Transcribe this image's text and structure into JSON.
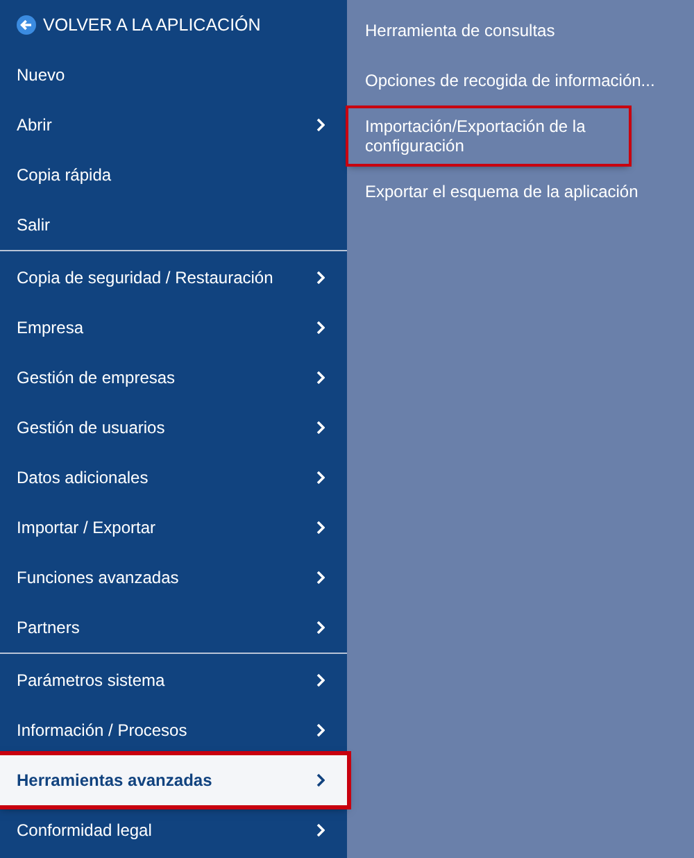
{
  "back_link": {
    "label": "VOLVER A LA APLICACIÓN"
  },
  "menu_groups": [
    {
      "items": [
        {
          "label": "Nuevo",
          "has_submenu": false,
          "selected": false,
          "highlighted": false
        },
        {
          "label": "Abrir",
          "has_submenu": true,
          "selected": false,
          "highlighted": false
        },
        {
          "label": "Copia rápida",
          "has_submenu": false,
          "selected": false,
          "highlighted": false
        },
        {
          "label": "Salir",
          "has_submenu": false,
          "selected": false,
          "highlighted": false
        }
      ]
    },
    {
      "items": [
        {
          "label": "Copia de seguridad / Restauración",
          "has_submenu": true,
          "selected": false,
          "highlighted": false
        },
        {
          "label": "Empresa",
          "has_submenu": true,
          "selected": false,
          "highlighted": false
        },
        {
          "label": "Gestión de empresas",
          "has_submenu": true,
          "selected": false,
          "highlighted": false
        },
        {
          "label": "Gestión de usuarios",
          "has_submenu": true,
          "selected": false,
          "highlighted": false
        },
        {
          "label": "Datos adicionales",
          "has_submenu": true,
          "selected": false,
          "highlighted": false
        },
        {
          "label": "Importar / Exportar",
          "has_submenu": true,
          "selected": false,
          "highlighted": false
        },
        {
          "label": "Funciones avanzadas",
          "has_submenu": true,
          "selected": false,
          "highlighted": false
        },
        {
          "label": "Partners",
          "has_submenu": true,
          "selected": false,
          "highlighted": false
        }
      ]
    },
    {
      "items": [
        {
          "label": "Parámetros sistema",
          "has_submenu": true,
          "selected": false,
          "highlighted": false
        },
        {
          "label": "Información / Procesos",
          "has_submenu": true,
          "selected": false,
          "highlighted": false
        },
        {
          "label": "Herramientas avanzadas",
          "has_submenu": true,
          "selected": true,
          "highlighted": true
        },
        {
          "label": "Conformidad legal",
          "has_submenu": true,
          "selected": false,
          "highlighted": false
        }
      ]
    }
  ],
  "submenu": [
    {
      "label": "Herramienta de consultas",
      "highlighted": false
    },
    {
      "label": "Opciones de recogida de información...",
      "highlighted": false
    },
    {
      "label": "Importación/Exportación de la configuración",
      "highlighted": true
    },
    {
      "label": "Exportar el esquema de la aplicación",
      "highlighted": false
    }
  ]
}
